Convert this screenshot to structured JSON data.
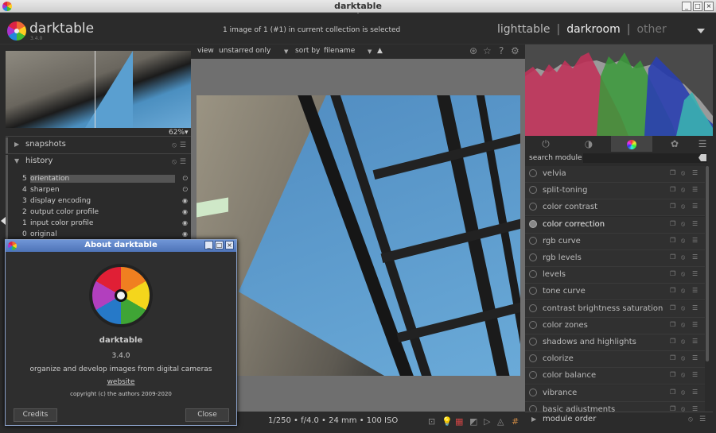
{
  "window": {
    "title": "darktable"
  },
  "header": {
    "app_name": "darktable",
    "version": "3.4.0",
    "selection_info": "1 image of 1 (#1) in current collection is selected",
    "views": {
      "lighttable": "lighttable",
      "separator": "|",
      "darkroom": "darkroom",
      "other": "other"
    }
  },
  "left": {
    "zoom": "62%▾",
    "snapshots": "snapshots",
    "history": "history",
    "history_items": [
      {
        "num": "5",
        "label": "orientation"
      },
      {
        "num": "4",
        "label": "sharpen"
      },
      {
        "num": "3",
        "label": "display encoding"
      },
      {
        "num": "2",
        "label": "output color profile"
      },
      {
        "num": "1",
        "label": "input color profile"
      },
      {
        "num": "0",
        "label": "original"
      }
    ]
  },
  "toolbar": {
    "view_label": "view",
    "view_value": "unstarred only",
    "sort_label": "sort by",
    "sort_value": "filename",
    "sort_dir": "▲"
  },
  "exif": "1/250 • f/4.0 • 24 mm • 100 ISO",
  "right": {
    "search_label": "search module",
    "search_value": "",
    "modules": [
      "velvia",
      "split-toning",
      "color contrast",
      "color correction",
      "rgb curve",
      "rgb levels",
      "levels",
      "tone curve",
      "contrast brightness saturation",
      "color zones",
      "shadows and highlights",
      "colorize",
      "color balance",
      "vibrance",
      "basic adjustments"
    ],
    "module_order": "module order"
  },
  "about": {
    "title": "About darktable",
    "name": "darktable",
    "version": "3.4.0",
    "tagline": "organize and develop images from digital cameras",
    "website": "website",
    "copyright": "copyright (c) the authors 2009-2020",
    "credits": "Credits",
    "close": "Close"
  }
}
